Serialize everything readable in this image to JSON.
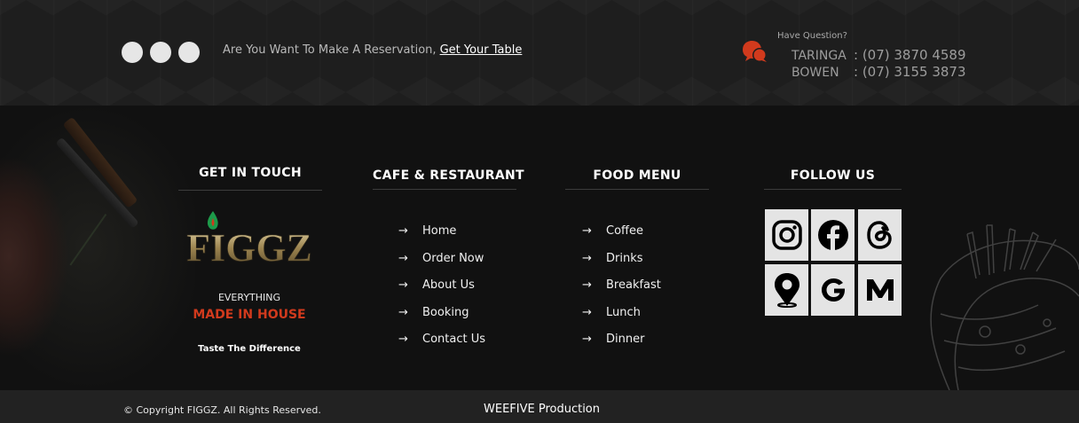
{
  "topbar": {
    "reservation_text": "Are You Want To Make A Reservation,",
    "reservation_link": "Get Your Table",
    "question_label": "Have Question?",
    "phones": [
      {
        "location": "TARINGA",
        "number": ": (07) 3870 4589"
      },
      {
        "location": "BOWEN",
        "number": ": (07) 3155 3873"
      }
    ]
  },
  "get_in_touch": {
    "title": "GET IN TOUCH",
    "logo_text": "FIGGZ",
    "tagline_top": "EVERYTHING",
    "tagline_main": "MADE IN HOUSE",
    "tagline_sub": "Taste The Difference"
  },
  "cafe": {
    "title": "CAFE & RESTAURANT",
    "items": [
      "Home",
      "Order Now",
      "About Us",
      "Booking",
      "Contact Us"
    ]
  },
  "food_menu": {
    "title": "FOOD MENU",
    "items": [
      "Coffee",
      "Drinks",
      "Breakfast",
      "Lunch",
      "Dinner"
    ]
  },
  "follow_us": {
    "title": "FOLLOW US",
    "icons": [
      "instagram-icon",
      "facebook-icon",
      "threads-icon",
      "map-pin-icon",
      "google-icon",
      "medium-icon"
    ]
  },
  "footer": {
    "copyright": "© Copyright FIGGZ. All Rights Reserved.",
    "credit": "WEEFIVE Production"
  },
  "colors": {
    "accent": "#d13a1d",
    "background": "#111111",
    "topbar": "#1e1e1e",
    "bottombar": "#222222"
  }
}
